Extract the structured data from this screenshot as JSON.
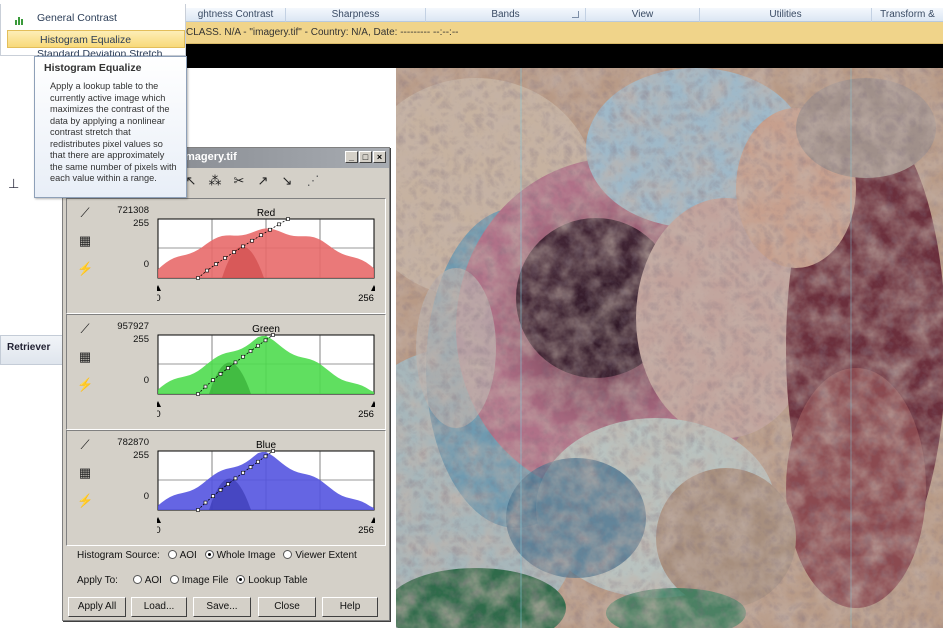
{
  "ribbon": {
    "groups": [
      "ghtness Contrast",
      "Sharpness",
      "Bands",
      "View",
      "Utilities",
      "Transform &"
    ]
  },
  "menu": {
    "items": [
      "General Contrast",
      "Histogram Equalize",
      "Standard Deviation Stretch"
    ],
    "selected": "Histogram Equalize"
  },
  "tooltip": {
    "title": "Histogram Equalize",
    "body": "Apply a lookup table to the currently active image which maximizes the contrast of the data by applying a nonlinear contrast stretch that redistributes pixel values so that there are approximately the same number of pixels with each value within a range."
  },
  "titlebar": {
    "text": "CLASS. N/A - \"imagery.tif\" - Country: N/A, Date: --------- --:--:--"
  },
  "left": {
    "retriever": "Retriever",
    "misc_glyph": "⊥"
  },
  "dialog": {
    "title": "magery.tif",
    "buttons": {
      "minimize": "_",
      "maximize": "□",
      "close": "×"
    },
    "toolbar_icons": [
      "pointer-icon",
      "node-icon",
      "scissors-icon",
      "curve-up-icon",
      "curve-down-icon",
      "dashed-line-icon"
    ],
    "panels": [
      {
        "name": "Red",
        "max": "721308",
        "top": "255",
        "zero": "0",
        "xmin": "0",
        "xmax": "256",
        "color": "#e86a6a",
        "peak": "#c84040"
      },
      {
        "name": "Green",
        "max": "957927",
        "top": "255",
        "zero": "0",
        "xmin": "0",
        "xmax": "256",
        "color": "#4fdc4f",
        "peak": "#2a9f2a"
      },
      {
        "name": "Blue",
        "max": "782870",
        "top": "255",
        "zero": "0",
        "xmin": "0",
        "xmax": "256",
        "color": "#5454e0",
        "peak": "#2f2fa8"
      }
    ],
    "histogram_source": {
      "label": "Histogram Source:",
      "options": [
        "AOI",
        "Whole Image",
        "Viewer Extent"
      ],
      "selected": "Whole Image"
    },
    "apply_to": {
      "label": "Apply To:",
      "options": [
        "AOI",
        "Image File",
        "Lookup Table"
      ],
      "selected": "Lookup Table"
    },
    "actions": [
      "Apply All",
      "Load...",
      "Save...",
      "Close",
      "Help"
    ]
  }
}
